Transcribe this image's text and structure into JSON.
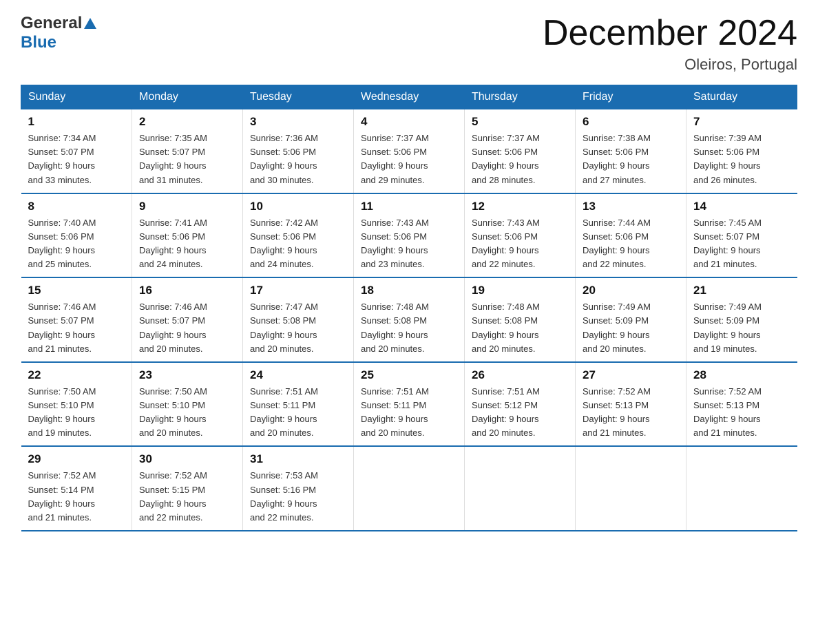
{
  "header": {
    "logo_general": "General",
    "logo_blue": "Blue",
    "month_title": "December 2024",
    "location": "Oleiros, Portugal"
  },
  "days_of_week": [
    "Sunday",
    "Monday",
    "Tuesday",
    "Wednesday",
    "Thursday",
    "Friday",
    "Saturday"
  ],
  "weeks": [
    [
      {
        "day": "1",
        "sunrise": "7:34 AM",
        "sunset": "5:07 PM",
        "daylight": "9 hours and 33 minutes."
      },
      {
        "day": "2",
        "sunrise": "7:35 AM",
        "sunset": "5:07 PM",
        "daylight": "9 hours and 31 minutes."
      },
      {
        "day": "3",
        "sunrise": "7:36 AM",
        "sunset": "5:06 PM",
        "daylight": "9 hours and 30 minutes."
      },
      {
        "day": "4",
        "sunrise": "7:37 AM",
        "sunset": "5:06 PM",
        "daylight": "9 hours and 29 minutes."
      },
      {
        "day": "5",
        "sunrise": "7:37 AM",
        "sunset": "5:06 PM",
        "daylight": "9 hours and 28 minutes."
      },
      {
        "day": "6",
        "sunrise": "7:38 AM",
        "sunset": "5:06 PM",
        "daylight": "9 hours and 27 minutes."
      },
      {
        "day": "7",
        "sunrise": "7:39 AM",
        "sunset": "5:06 PM",
        "daylight": "9 hours and 26 minutes."
      }
    ],
    [
      {
        "day": "8",
        "sunrise": "7:40 AM",
        "sunset": "5:06 PM",
        "daylight": "9 hours and 25 minutes."
      },
      {
        "day": "9",
        "sunrise": "7:41 AM",
        "sunset": "5:06 PM",
        "daylight": "9 hours and 24 minutes."
      },
      {
        "day": "10",
        "sunrise": "7:42 AM",
        "sunset": "5:06 PM",
        "daylight": "9 hours and 24 minutes."
      },
      {
        "day": "11",
        "sunrise": "7:43 AM",
        "sunset": "5:06 PM",
        "daylight": "9 hours and 23 minutes."
      },
      {
        "day": "12",
        "sunrise": "7:43 AM",
        "sunset": "5:06 PM",
        "daylight": "9 hours and 22 minutes."
      },
      {
        "day": "13",
        "sunrise": "7:44 AM",
        "sunset": "5:06 PM",
        "daylight": "9 hours and 22 minutes."
      },
      {
        "day": "14",
        "sunrise": "7:45 AM",
        "sunset": "5:07 PM",
        "daylight": "9 hours and 21 minutes."
      }
    ],
    [
      {
        "day": "15",
        "sunrise": "7:46 AM",
        "sunset": "5:07 PM",
        "daylight": "9 hours and 21 minutes."
      },
      {
        "day": "16",
        "sunrise": "7:46 AM",
        "sunset": "5:07 PM",
        "daylight": "9 hours and 20 minutes."
      },
      {
        "day": "17",
        "sunrise": "7:47 AM",
        "sunset": "5:08 PM",
        "daylight": "9 hours and 20 minutes."
      },
      {
        "day": "18",
        "sunrise": "7:48 AM",
        "sunset": "5:08 PM",
        "daylight": "9 hours and 20 minutes."
      },
      {
        "day": "19",
        "sunrise": "7:48 AM",
        "sunset": "5:08 PM",
        "daylight": "9 hours and 20 minutes."
      },
      {
        "day": "20",
        "sunrise": "7:49 AM",
        "sunset": "5:09 PM",
        "daylight": "9 hours and 20 minutes."
      },
      {
        "day": "21",
        "sunrise": "7:49 AM",
        "sunset": "5:09 PM",
        "daylight": "9 hours and 19 minutes."
      }
    ],
    [
      {
        "day": "22",
        "sunrise": "7:50 AM",
        "sunset": "5:10 PM",
        "daylight": "9 hours and 19 minutes."
      },
      {
        "day": "23",
        "sunrise": "7:50 AM",
        "sunset": "5:10 PM",
        "daylight": "9 hours and 20 minutes."
      },
      {
        "day": "24",
        "sunrise": "7:51 AM",
        "sunset": "5:11 PM",
        "daylight": "9 hours and 20 minutes."
      },
      {
        "day": "25",
        "sunrise": "7:51 AM",
        "sunset": "5:11 PM",
        "daylight": "9 hours and 20 minutes."
      },
      {
        "day": "26",
        "sunrise": "7:51 AM",
        "sunset": "5:12 PM",
        "daylight": "9 hours and 20 minutes."
      },
      {
        "day": "27",
        "sunrise": "7:52 AM",
        "sunset": "5:13 PM",
        "daylight": "9 hours and 21 minutes."
      },
      {
        "day": "28",
        "sunrise": "7:52 AM",
        "sunset": "5:13 PM",
        "daylight": "9 hours and 21 minutes."
      }
    ],
    [
      {
        "day": "29",
        "sunrise": "7:52 AM",
        "sunset": "5:14 PM",
        "daylight": "9 hours and 21 minutes."
      },
      {
        "day": "30",
        "sunrise": "7:52 AM",
        "sunset": "5:15 PM",
        "daylight": "9 hours and 22 minutes."
      },
      {
        "day": "31",
        "sunrise": "7:53 AM",
        "sunset": "5:16 PM",
        "daylight": "9 hours and 22 minutes."
      },
      null,
      null,
      null,
      null
    ]
  ],
  "labels": {
    "sunrise": "Sunrise:",
    "sunset": "Sunset:",
    "daylight": "Daylight:"
  }
}
